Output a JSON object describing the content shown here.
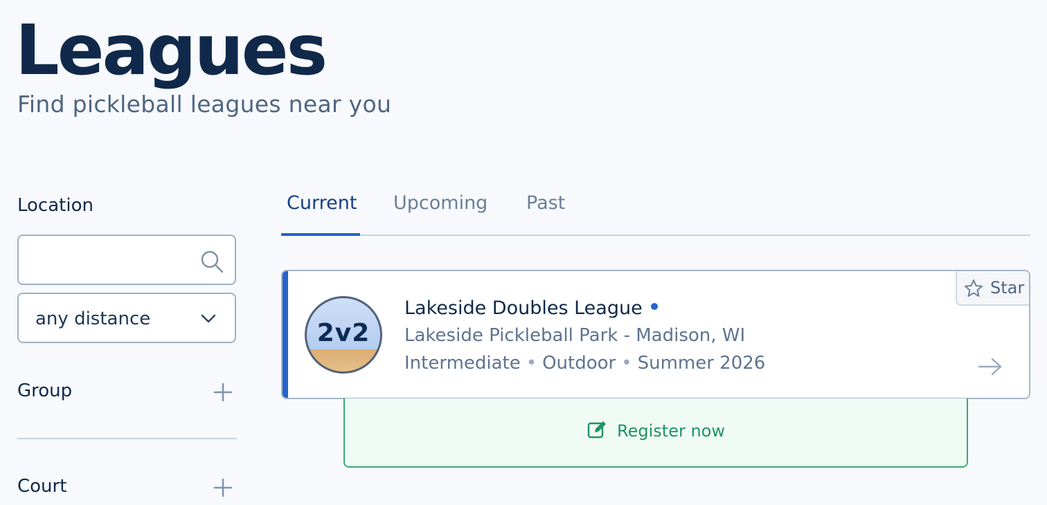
{
  "header": {
    "title": "Leagues",
    "subtitle": "Find pickleball leagues near you"
  },
  "filters": {
    "location_label": "Location",
    "search_value": "",
    "distance_value": "any distance",
    "group_label": "Group",
    "court_label": "Court"
  },
  "tabs": [
    {
      "label": "Current",
      "active": true
    },
    {
      "label": "Upcoming",
      "active": false
    },
    {
      "label": "Past",
      "active": false
    }
  ],
  "league": {
    "badge": "2v2",
    "name": "Lakeside Doubles League",
    "location": "Lakeside Pickleball Park - Madison, WI",
    "level": "Intermediate",
    "setting": "Outdoor",
    "season": "Summer 2026",
    "star_label": "Star"
  },
  "register": {
    "label": "Register now"
  },
  "icons": {
    "search": "search-icon",
    "chevron": "chevron-down-icon",
    "plus": "plus-icon",
    "star": "star-icon",
    "arrow": "arrow-right-icon",
    "edit": "edit-icon"
  },
  "colors": {
    "accent": "#2564c9",
    "title": "#10294a",
    "register_green": "#1f9466"
  }
}
